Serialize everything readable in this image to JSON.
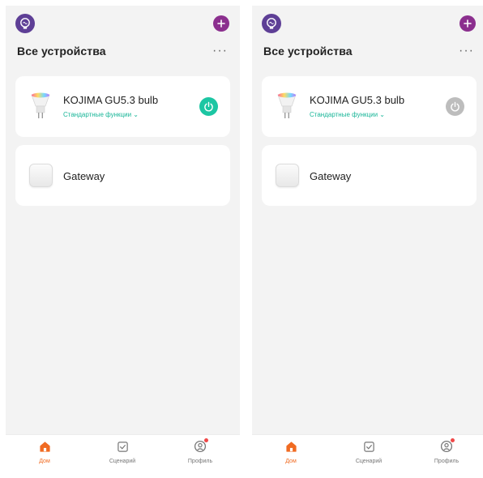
{
  "screens": [
    {
      "id": "left",
      "header": {
        "title": "Все устройства",
        "more": "···"
      },
      "devices": [
        {
          "name": "KOJIMA GU5.3 bulb",
          "functions": "Стандартные функции",
          "functions_chevron": "⌄",
          "power": "on"
        },
        {
          "name": "Gateway"
        }
      ],
      "tabs": [
        {
          "label": "Дом",
          "active": true
        },
        {
          "label": "Сценарий",
          "active": false
        },
        {
          "label": "Профиль",
          "active": false
        }
      ]
    },
    {
      "id": "right",
      "header": {
        "title": "Все устройства",
        "more": "···"
      },
      "devices": [
        {
          "name": "KOJIMA GU5.3 bulb",
          "functions": "Стандартные функции",
          "functions_chevron": "⌄",
          "power": "off"
        },
        {
          "name": "Gateway"
        }
      ],
      "tabs": [
        {
          "label": "Дом",
          "active": true
        },
        {
          "label": "Сценарий",
          "active": false
        },
        {
          "label": "Профиль",
          "active": false
        }
      ]
    }
  ],
  "colors": {
    "accent_green": "#1cc6a3",
    "power_off": "#bdbdbd",
    "add_button": "#8b2f8e",
    "active_tab": "#f06b22",
    "background": "#f3f3f3"
  },
  "icons": {
    "avatar": "smart-bulb-avatar-icon",
    "add": "plus-icon",
    "power": "power-icon",
    "home": "home-icon",
    "scenes": "checkbox-icon",
    "profile": "profile-icon"
  }
}
